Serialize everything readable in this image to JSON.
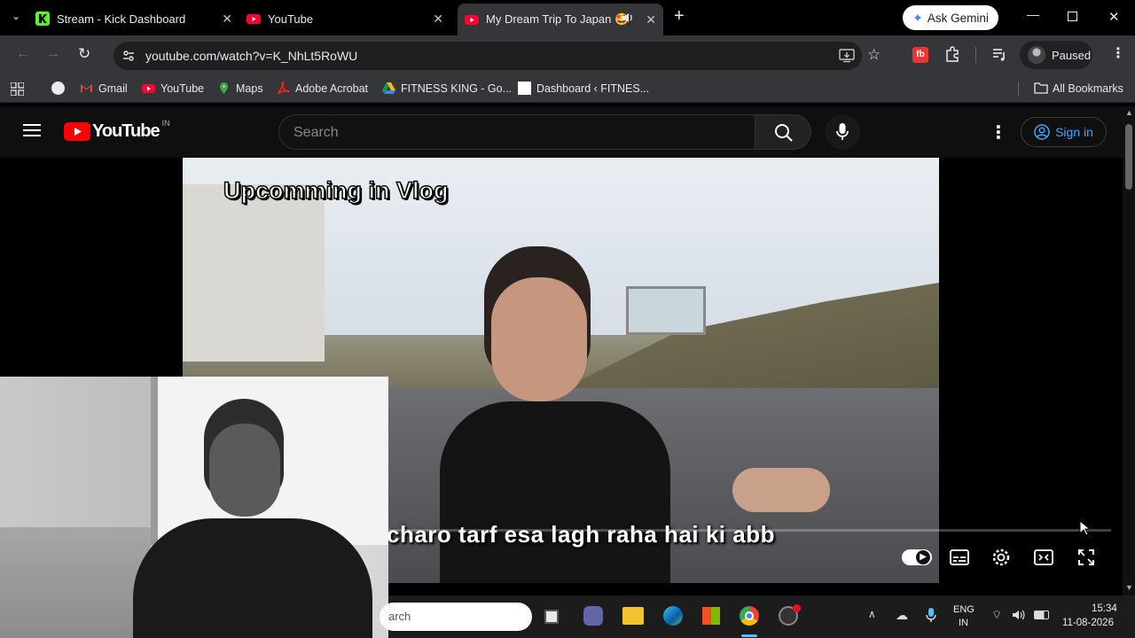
{
  "browser": {
    "tabs": [
      {
        "title": "Stream - Kick Dashboard",
        "icon": "kick-icon"
      },
      {
        "title": "YouTube",
        "icon": "youtube-icon"
      },
      {
        "title": "My Dream Trip To Japan 🤩",
        "icon": "youtube-icon",
        "active": true,
        "audio": true
      }
    ],
    "ask_gemini": "Ask Gemini",
    "url": "youtube.com/watch?v=K_NhLt5RoWU",
    "profile_status": "Paused",
    "bookmarks": [
      "Gmail",
      "YouTube",
      "Maps",
      "Adobe Acrobat",
      "FITNESS KING - Go...",
      "Dashboard ‹ FITNES..."
    ],
    "all_bookmarks": "All Bookmarks"
  },
  "youtube": {
    "logo_text": "YouTube",
    "region": "IN",
    "search_placeholder": "Search",
    "sign_in": "Sign in"
  },
  "video": {
    "overlay_title": "Upcomming in Vlog",
    "subtitle": "charo tarf esa lagh raha hai ki abb"
  },
  "taskbar": {
    "search_text": "arch",
    "lang_top": "ENG",
    "lang_bottom": "IN",
    "time": "15:34",
    "date": "11-08-2026"
  },
  "colors": {
    "youtube_red": "#ff0000",
    "link_blue": "#3ea6ff",
    "chrome_dark": "#35363a"
  }
}
